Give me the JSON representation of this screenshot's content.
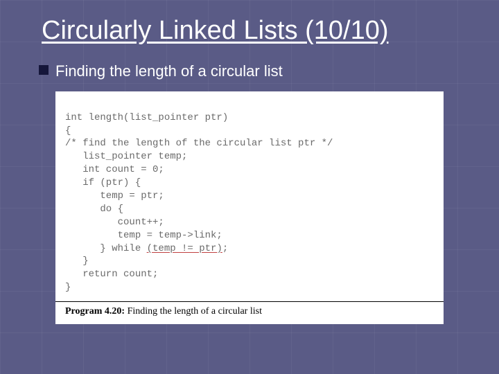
{
  "slide": {
    "title": "Circularly Linked Lists (10/10)",
    "bullet": "Finding the length of a circular list"
  },
  "code": {
    "l1": "int length(list_pointer ptr)",
    "l2": "{",
    "l3": "/* find the length of the circular list ptr */",
    "l4": "   list_pointer temp;",
    "l5": "   int count = 0;",
    "l6": "   if (ptr) {",
    "l7": "      temp = ptr;",
    "l8": "      do {",
    "l9": "         count++;",
    "l10": "         temp = temp->link;",
    "l11a": "      } while ",
    "l11b": "(temp != ptr)",
    "l11c": ";",
    "l12": "   }",
    "l13": "   return count;",
    "l14": "}"
  },
  "caption": {
    "program_label": "Program 4.20:",
    "program_text": " Finding the length of a circular list"
  }
}
